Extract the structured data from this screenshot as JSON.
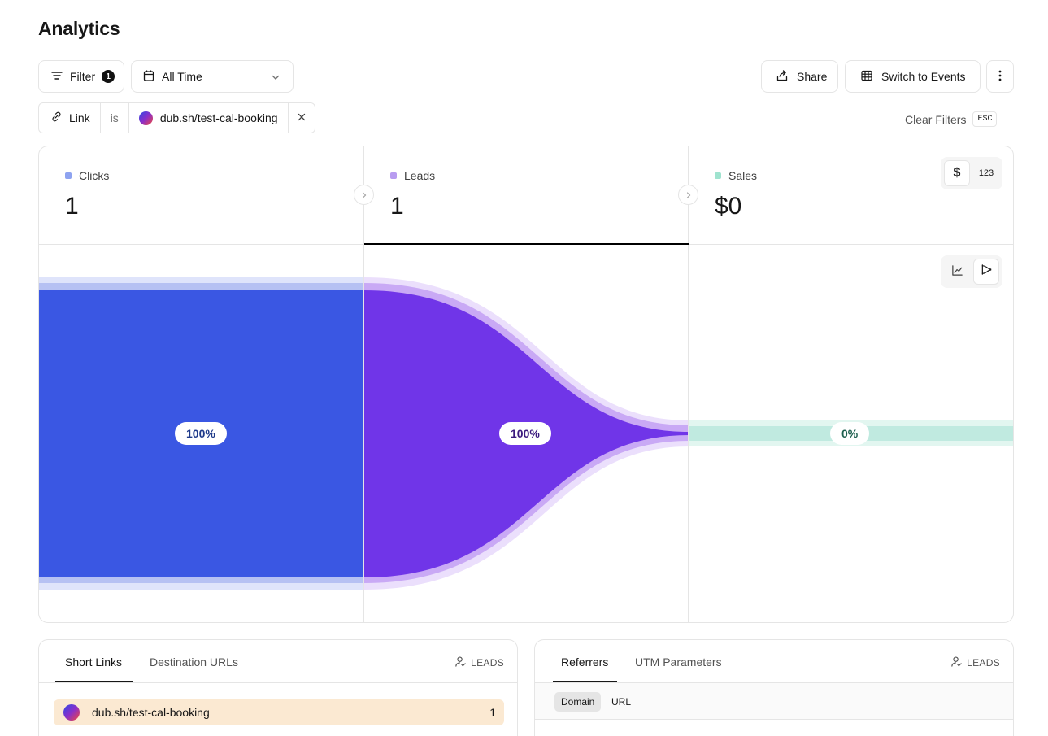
{
  "page": {
    "title": "Analytics"
  },
  "toolbar": {
    "filter_label": "Filter",
    "filter_count": "1",
    "date_range": "All Time",
    "share_label": "Share",
    "switch_label": "Switch to Events"
  },
  "active_filter": {
    "field": "Link",
    "operator": "is",
    "value": "dub.sh/test-cal-booking"
  },
  "clear_filters": {
    "label": "Clear Filters",
    "shortcut": "ESC"
  },
  "metrics": [
    {
      "label": "Clicks",
      "value": "1",
      "color": "#8ea3f0"
    },
    {
      "label": "Leads",
      "value": "1",
      "color": "#b89cf0"
    },
    {
      "label": "Sales",
      "value": "$0",
      "color": "#9fe3cf"
    }
  ],
  "display_toggle": {
    "currency": "$",
    "count": "123"
  },
  "funnel": {
    "clicks_pct": "100%",
    "leads_pct": "100%",
    "sales_pct": "0%",
    "colors": {
      "clicks": "#3a57e3",
      "leads": "#7035e8",
      "sales": "#c0eae0"
    }
  },
  "links_card": {
    "tabs": [
      "Short Links",
      "Destination URLs"
    ],
    "meta": "LEADS",
    "rows": [
      {
        "label": "dub.sh/test-cal-booking",
        "value": "1"
      }
    ]
  },
  "referrers_card": {
    "tabs": [
      "Referrers",
      "UTM Parameters"
    ],
    "meta": "LEADS",
    "subtabs": [
      "Domain",
      "URL"
    ]
  }
}
